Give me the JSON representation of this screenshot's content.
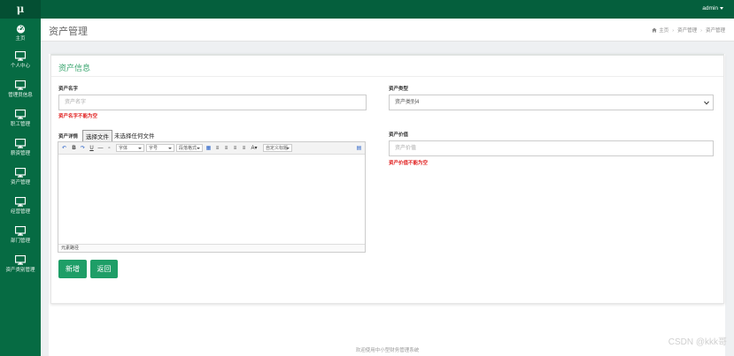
{
  "logo": "μ",
  "header": {
    "user": "admin"
  },
  "sidebar": {
    "items": [
      {
        "label": "主页",
        "icon": "dashboard-icon"
      },
      {
        "label": "个人中心",
        "icon": "monitor-icon"
      },
      {
        "label": "管理员信息",
        "icon": "monitor-icon"
      },
      {
        "label": "职工管理",
        "icon": "monitor-icon"
      },
      {
        "label": "薪资管理",
        "icon": "monitor-icon"
      },
      {
        "label": "资产管理",
        "icon": "monitor-icon"
      },
      {
        "label": "经营管理",
        "icon": "monitor-icon"
      },
      {
        "label": "部门管理",
        "icon": "monitor-icon"
      },
      {
        "label": "资产类别管理",
        "icon": "monitor-icon"
      }
    ]
  },
  "page": {
    "title": "资产管理",
    "breadcrumb": [
      "主页",
      "资产管理",
      "资产管理"
    ]
  },
  "form": {
    "title": "资产信息",
    "asset_name": {
      "label": "资产名字",
      "placeholder": "资产名字",
      "error": "资产名字不能为空"
    },
    "asset_type": {
      "label": "资产类型",
      "selected": "资产类别4"
    },
    "asset_detail": {
      "label": "资产详情",
      "file_button": "选择文件",
      "file_status": "未选择任何文件"
    },
    "asset_value": {
      "label": "资产价值",
      "placeholder": "资产价值",
      "error": "资产价值不能为空"
    },
    "editor": {
      "font_family": "字体",
      "font_size": "字号",
      "paragraph": "段落格式",
      "custom_title": "自定义标题",
      "status": "元素路径"
    },
    "buttons": {
      "add": "新增",
      "back": "返回"
    }
  },
  "footer": {
    "text": "欢迎使用中小型财务管理系统"
  },
  "watermark": "CSDN @kkk哥",
  "colors": {
    "topbar": "#055f3d",
    "sidebar": "#066b43",
    "accent": "#1e9e67",
    "error": "#e02020"
  }
}
